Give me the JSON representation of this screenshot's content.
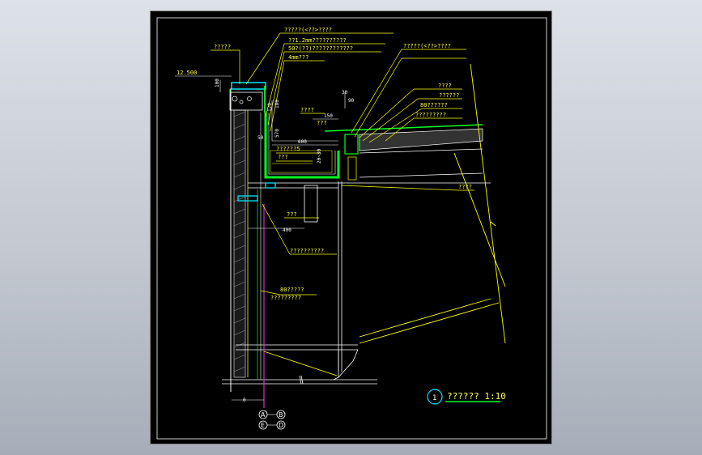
{
  "colors": {
    "label": "#ffff44",
    "line": "#ffff00",
    "green": "#00ff22",
    "cyan": "#00e5ff",
    "magenta": "#ff33ff",
    "white": "#ffffff",
    "sheet": "#000000"
  },
  "level": {
    "value": "12.500"
  },
  "labels": {
    "l1": "?????",
    "l2": "?????(<??>????",
    "l3": "??1.2mm??????????",
    "l4": "50?(??)????????????",
    "l5": "4mm???",
    "l6": "?????(<??>????",
    "l7": "????",
    "l8": "??????",
    "l9": "80??????",
    "l10": "?????????",
    "l11": "????",
    "l12": "??????5",
    "l13": "???",
    "l14": "???",
    "l15": "????",
    "l16": "???",
    "l17": "??????????",
    "l18": "80?????",
    "l19": "?????????"
  },
  "dims": {
    "d100": "100",
    "d120": "120",
    "d180": "180",
    "d150": "150",
    "d50": "50",
    "d570": "570",
    "d600": "600",
    "d30": "30",
    "d90": "90",
    "d2030": "20~30",
    "d400": "400",
    "d0": "0"
  },
  "axes": {
    "a": "A",
    "b": "B",
    "e": "E",
    "d": "D"
  },
  "title": {
    "text": "??????  1:10",
    "number": "1"
  }
}
